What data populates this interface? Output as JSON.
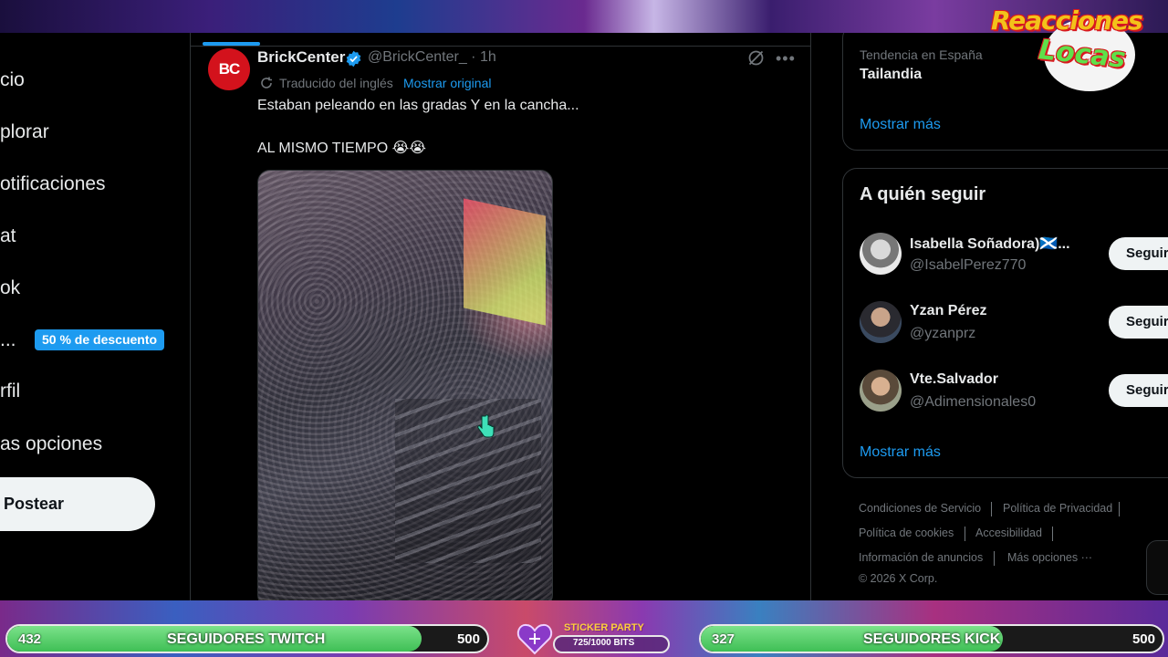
{
  "nav": {
    "items": [
      "cio",
      "plorar",
      "otificaciones",
      "at",
      "ok",
      "...",
      "rfil",
      "as opciones"
    ],
    "premium_badge": "50 % de descuento",
    "post_label": "Postear"
  },
  "tweet": {
    "avatar_text": "BC",
    "author": "BrickCenter",
    "handle": "@BrickCenter_",
    "time": "· 1h",
    "translated_label": "Traducido del inglés",
    "show_original": "Mostrar original",
    "text_line1": "Estaban peleando en las gradas Y en la cancha...",
    "text_line2": "AL MISMO TIEMPO 😭😭"
  },
  "sidebar": {
    "trend": {
      "category": "Tendencia en España",
      "name": "Tailandia",
      "show_more": "Mostrar más"
    },
    "who_to_follow": {
      "title": "A quién seguir",
      "users": [
        {
          "name": "Isabella Soñadora)🏴󠁧󠁢󠁳󠁣󠁴󠁿...",
          "handle": "@IsabelPerez770",
          "button": "Seguir"
        },
        {
          "name": "Yzan Pérez",
          "handle": "@yzanprz",
          "button": "Seguir"
        },
        {
          "name": "Vte.Salvador",
          "handle": "@Adimensionales0",
          "button": "Seguir"
        }
      ],
      "show_more": "Mostrar más"
    },
    "footer": {
      "links": [
        "Condiciones de Servicio",
        "Política de Privacidad",
        "Política de cookies",
        "Accesibilidad",
        "Información de anuncios",
        "Más opciones ···"
      ],
      "copyright": "© 2026 X Corp."
    }
  },
  "overlay": {
    "logo_line1": "Reacciones",
    "logo_line2": "Locas",
    "twitch": {
      "current": "432",
      "title": "SEGUIDORES TWITCH",
      "goal": "500",
      "progress": 0.864
    },
    "kick": {
      "current": "327",
      "title": "SEGUIDORES KICK",
      "goal": "500",
      "progress": 0.654
    },
    "sticker": {
      "title": "STICKER PARTY",
      "value": "725/1000 BITS",
      "progress": 0.725
    }
  },
  "colors": {
    "accent": "#1d9bf0",
    "background": "#000000",
    "text": "#e7e9ea",
    "muted": "#71767b",
    "progress_green": "#3fbf55"
  }
}
